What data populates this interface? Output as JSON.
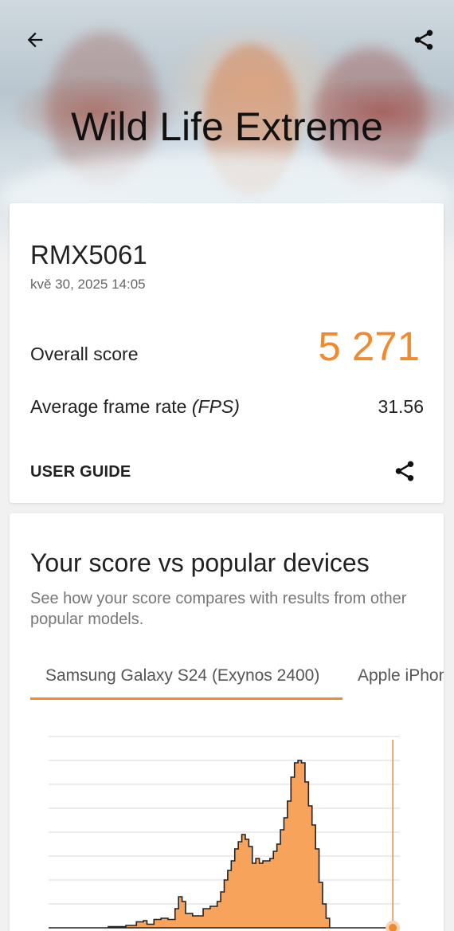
{
  "header": {
    "title": "Wild Life Extreme",
    "back_icon": "arrow-back-icon",
    "share_icon": "share-icon"
  },
  "result": {
    "device": "RMX5061",
    "timestamp": "kvě 30, 2025 14:05",
    "overall_label": "Overall score",
    "overall_value": "5 271",
    "fps_label": "Average frame rate ",
    "fps_unit": "(FPS)",
    "fps_value": "31.56",
    "guide_label": "USER GUIDE"
  },
  "comparison": {
    "title": "Your score vs popular devices",
    "subtitle": "See how your score compares with results from other popular models.",
    "tabs": [
      {
        "label": "Samsung Galaxy S24 (Exynos 2400)",
        "selected": true
      },
      {
        "label": "Apple iPhone",
        "selected": false
      }
    ]
  },
  "colors": {
    "accent": "#f08a2c",
    "histogram_fill": "#f7a35c",
    "text_primary": "#222222",
    "text_secondary": "#777777"
  },
  "chart_data": {
    "type": "area",
    "title": "",
    "xlabel": "",
    "ylabel": "",
    "ylim": [
      0,
      8
    ],
    "xlim": [
      0,
      100
    ],
    "grid": true,
    "marker_x": 98,
    "series": [
      {
        "values": [
          [
            0,
            0
          ],
          [
            14,
            0
          ],
          [
            17,
            0.05
          ],
          [
            22,
            0.1
          ],
          [
            25,
            0.25
          ],
          [
            27,
            0.3
          ],
          [
            28,
            0.15
          ],
          [
            30,
            0.35
          ],
          [
            32,
            0.4
          ],
          [
            34,
            0.35
          ],
          [
            36,
            0.8
          ],
          [
            37,
            1.3
          ],
          [
            38,
            1.1
          ],
          [
            39,
            0.6
          ],
          [
            41,
            0.5
          ],
          [
            44,
            0.8
          ],
          [
            46,
            0.9
          ],
          [
            48,
            1.1
          ],
          [
            49,
            1.5
          ],
          [
            50,
            2.0
          ],
          [
            51,
            2.4
          ],
          [
            52,
            2.8
          ],
          [
            53,
            3.3
          ],
          [
            54,
            3.6
          ],
          [
            55,
            3.9
          ],
          [
            56,
            3.7
          ],
          [
            57,
            3.4
          ],
          [
            58,
            2.7
          ],
          [
            59,
            2.9
          ],
          [
            60,
            2.7
          ],
          [
            61,
            2.8
          ],
          [
            62,
            2.8
          ],
          [
            63,
            2.9
          ],
          [
            64,
            3.2
          ],
          [
            65,
            3.5
          ],
          [
            66,
            4.1
          ],
          [
            67,
            4.6
          ],
          [
            68,
            5.3
          ],
          [
            69,
            6.3
          ],
          [
            70,
            6.9
          ],
          [
            71,
            7.0
          ],
          [
            72,
            6.9
          ],
          [
            73,
            6.1
          ],
          [
            74,
            5.1
          ],
          [
            75,
            4.3
          ],
          [
            76,
            3.3
          ],
          [
            77,
            1.9
          ],
          [
            78,
            1.0
          ],
          [
            79,
            0.4
          ],
          [
            80,
            0
          ],
          [
            100,
            0
          ]
        ]
      }
    ]
  }
}
